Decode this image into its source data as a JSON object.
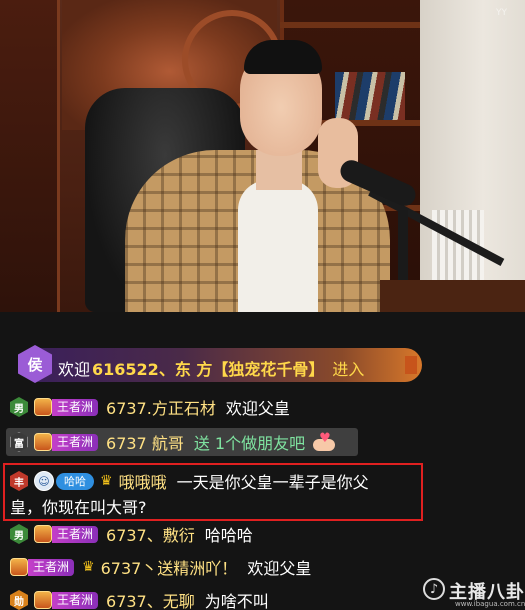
{
  "chat": {
    "welcome": {
      "badge": "侯",
      "prefix": "欢迎",
      "name": "616522、东 方【独宠花千骨】",
      "action": "进入"
    },
    "messages": [
      {
        "gender": "男",
        "guild": "王者洲",
        "user": "6737.方正石材",
        "text": "欢迎父皇"
      },
      {
        "gender": "富",
        "guild": "王者洲",
        "user": "6737 航哥",
        "text": "送 1个做朋友吧",
        "type": "gift"
      },
      {
        "gender": "丰",
        "fan_badge": "哈哈",
        "user": "哦哦哦",
        "text_line1": "一天是你父皇一辈子是你父",
        "text_line2": "皇，你现在叫大哥?",
        "highlighted": true
      },
      {
        "gender": "男",
        "guild": "王者洲",
        "user": "6737、敷衍",
        "text": "哈哈哈"
      },
      {
        "guild": "王者洲",
        "user": "6737丶送精洲吖！",
        "text": "欢迎父皇"
      },
      {
        "guild": "王者洲",
        "user": "6737、无聊",
        "text": "为啥不叫"
      }
    ]
  },
  "watermark": {
    "logo_text": "主播八卦",
    "url": "www.ibagua.com.cn",
    "corner": "YY"
  },
  "colors": {
    "username": "#ffe184",
    "highlight_border": "#e02020",
    "guild_badge": "#b23fc4"
  }
}
